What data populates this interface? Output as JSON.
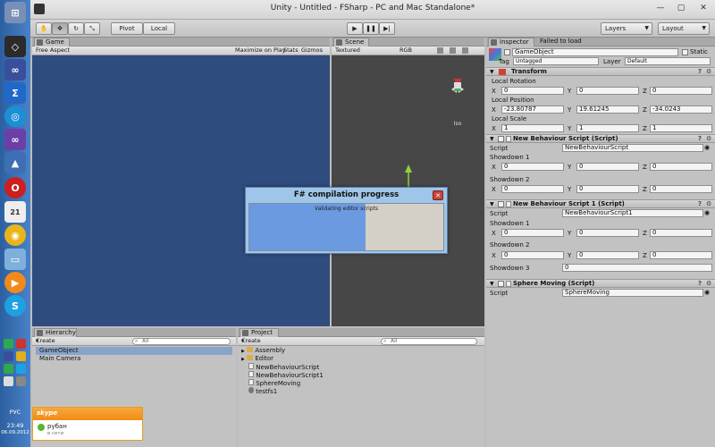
{
  "window": {
    "title": "Unity - Untitled - FSharp - PC and Mac Standalone*"
  },
  "toolbar": {
    "pivot_label": "Pivot",
    "local_label": "Local",
    "layers_label": "Layers",
    "layout_label": "Layout"
  },
  "game": {
    "tab_label": "Game",
    "aspect_label": "Free Aspect",
    "maximize_label": "Maximize on Play",
    "stats_label": "Stats",
    "gizmos_label": "Gizmos"
  },
  "scene": {
    "tab_label": "Scene",
    "render_mode": "Textured",
    "color_mode": "RGB",
    "iso_label": "Iso"
  },
  "inspector": {
    "tab_label": "Inspector",
    "tab2_label": "Failed to load",
    "object_name": "GameObject",
    "static_label": "Static",
    "tag_label": "Tag",
    "tag_value": "Untagged",
    "layer_label": "Layer",
    "layer_value": "Default",
    "transform": {
      "title": "Transform",
      "rotation_label": "Local Rotation",
      "rotation": {
        "x": "0",
        "y": "0",
        "z": "0"
      },
      "position_label": "Local Position",
      "position": {
        "x": "-23.80787",
        "y": "19.61245",
        "z": "-34.0243"
      },
      "scale_label": "Local Scale",
      "scale": {
        "x": "1",
        "y": "1",
        "z": "1"
      }
    },
    "axis": {
      "x": "X",
      "y": "Y",
      "z": "Z"
    },
    "script_label": "Script",
    "comp1": {
      "title": "New Behaviour Script (Script)",
      "script_value": "NewBehaviourScript",
      "showdown1_label": "Showdown 1",
      "showdown1": {
        "x": "0",
        "y": "0",
        "z": "0"
      },
      "showdown2_label": "Showdown 2",
      "showdown2": {
        "x": "0",
        "y": "0",
        "z": "0"
      }
    },
    "comp2": {
      "title": "New Behaviour Script 1 (Script)",
      "script_value": "NewBehaviourScript1",
      "showdown1_label": "Showdown 1",
      "showdown1": {
        "x": "0",
        "y": "0",
        "z": "0"
      },
      "showdown2_label": "Showdown 2",
      "showdown2": {
        "x": "0",
        "y": "0",
        "z": "0"
      },
      "showdown3_label": "Showdown 3",
      "showdown3_value": "0"
    },
    "comp3": {
      "title": "Sphere Moving (Script)",
      "script_value": "SphereMoving"
    }
  },
  "hierarchy": {
    "tab_label": "Hierarchy",
    "create_label": "Create",
    "search_placeholder": "All",
    "items": [
      "GameObject",
      "Main Camera"
    ]
  },
  "project": {
    "tab_label": "Project",
    "create_label": "Create",
    "search_placeholder": "All",
    "items": [
      "Assembly",
      "Editor",
      "NewBehaviourScript",
      "NewBehaviourScript1",
      "SphereMoving",
      "testfs1"
    ]
  },
  "dialog": {
    "title": "F# compilation progress",
    "message": "Validating editor scripts",
    "progress": 0.6
  },
  "skype": {
    "logo": "skype",
    "name": "рубан",
    "status": "в сети"
  },
  "taskbar": {
    "lang": "РУС",
    "time": "23:49",
    "date": "06.09.2012"
  }
}
